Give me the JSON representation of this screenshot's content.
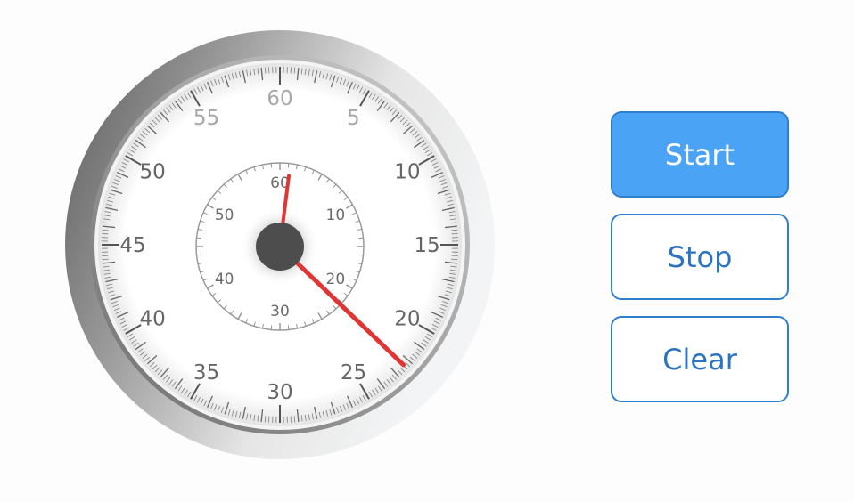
{
  "dial": {
    "outer_labels": [
      "60",
      "5",
      "10",
      "15",
      "20",
      "25",
      "30",
      "35",
      "40",
      "45",
      "50",
      "55"
    ],
    "inner_labels": [
      "60",
      "10",
      "20",
      "30",
      "40",
      "50"
    ],
    "outer_hand_seconds": 22.3,
    "inner_hand_minutes": 1.2,
    "hand_color": "#e03535",
    "outer_label_color": "#a8a8a8",
    "inner_label_color": "#6b6b6b"
  },
  "controls": {
    "start_label": "Start",
    "stop_label": "Stop",
    "clear_label": "Clear",
    "accent": "#4aa3f5",
    "border": "#2f7fcf"
  }
}
